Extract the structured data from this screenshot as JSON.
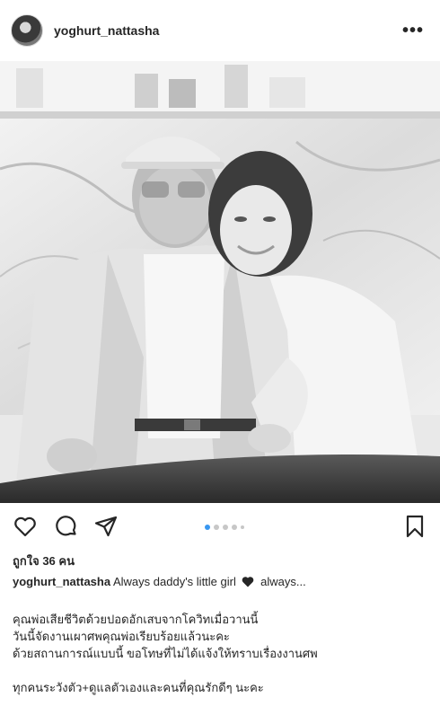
{
  "post": {
    "username": "yoghurt_nattasha",
    "more_label": "•••"
  },
  "icons": {
    "avatar": "avatar",
    "like": "heart-outline-icon",
    "comment": "comment-bubble-icon",
    "share": "paper-plane-icon",
    "save": "bookmark-icon",
    "caption_heart": "black-heart-icon"
  },
  "carousel": {
    "count": 5,
    "active_index": 0
  },
  "stats": {
    "likes": "ถูกใจ 36 คน"
  },
  "caption": {
    "username": "yoghurt_nattasha",
    "text_before": "Always daddy's little girl",
    "text_after": "always...",
    "lines": [
      "คุณพ่อเสียชีวิตด้วยปอดอักเสบจากโควิทเมื่อวานนี้",
      "วันนี้จัดงานเผาศพคุณพ่อเรียบร้อยแล้วนะคะ",
      "ด้วยสถานการณ์แบบนี้ ขอโทษที่ไม่ได้แจ้งให้ทราบเรื่องงานศพ",
      "",
      "ทุกคนระวังตัว+ดูแลตัวเองและคนที่คุณรักดีๆ นะคะ"
    ]
  },
  "colors": {
    "text": "#262626",
    "carousel_active": "#3897f0",
    "carousel_inactive": "#c7c7c7"
  }
}
